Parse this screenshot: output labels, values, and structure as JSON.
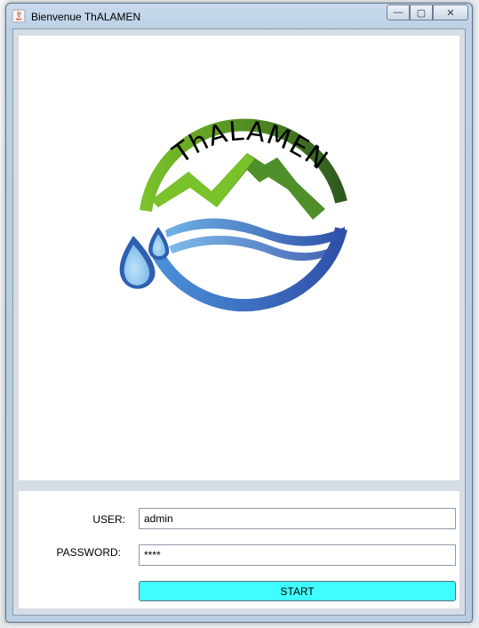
{
  "window": {
    "title": "Bienvenue ThALAMEN",
    "minimize_label": "—",
    "maximize_label": "▢",
    "close_label": "✕"
  },
  "logo": {
    "text": "ThALAMEN",
    "icon_name": "thalamen-logo",
    "colors": {
      "green_light": "#7ac22a",
      "green_dark": "#2e5a1e",
      "blue_light": "#5aa6e0",
      "blue_dark": "#2f4fa8",
      "drop_fill": "#8cc8ee"
    }
  },
  "login": {
    "user_label": "USER:",
    "user_value": "admin",
    "password_label": "PASSWORD:",
    "password_value": "****",
    "start_label": "START",
    "start_color": "#40fdff"
  }
}
